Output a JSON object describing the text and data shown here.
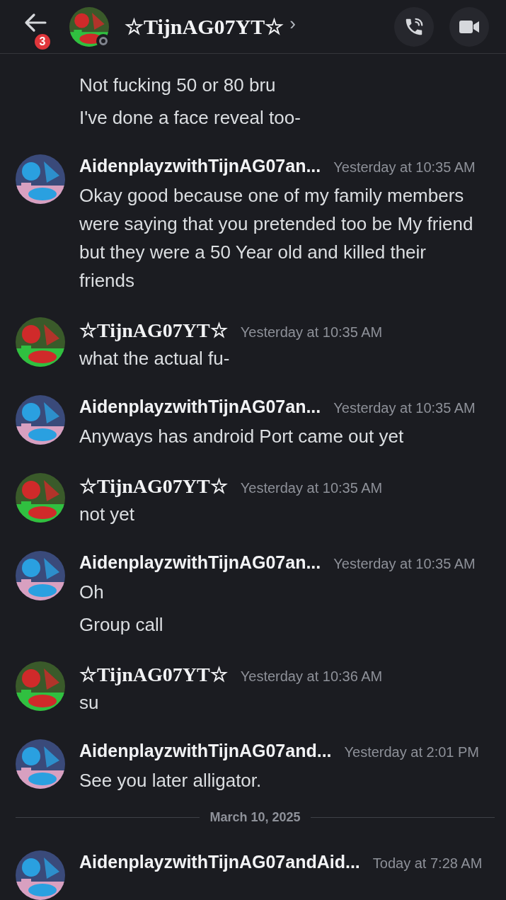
{
  "header": {
    "title": "☆TijnAG07YT☆",
    "chevron": "›",
    "badge": "3",
    "online": false
  },
  "feed": [
    {
      "kind": "continuation",
      "messages": [
        "Not fucking 50 or 80 bru",
        "I've done a face reveal too-"
      ]
    },
    {
      "kind": "group",
      "serif_name": false,
      "author": "AidenplayzwithTijnAG07an...",
      "time": "Yesterday at 10:35 AM",
      "messages": [
        "Okay good because one of my family members were saying that you pretended too be My friend but they were a 50 Year old and killed their friends"
      ]
    },
    {
      "kind": "group",
      "serif_name": true,
      "author": "☆TijnAG07YT☆",
      "time": "Yesterday at 10:35 AM",
      "messages": [
        "what the actual fu-"
      ]
    },
    {
      "kind": "group",
      "serif_name": false,
      "author": "AidenplayzwithTijnAG07an...",
      "time": "Yesterday at 10:35 AM",
      "messages": [
        "Anyways has android Port came out yet"
      ]
    },
    {
      "kind": "group",
      "serif_name": true,
      "author": "☆TijnAG07YT☆",
      "time": "Yesterday at 10:35 AM",
      "messages": [
        "not yet"
      ]
    },
    {
      "kind": "group",
      "serif_name": false,
      "author": "AidenplayzwithTijnAG07an...",
      "time": "Yesterday at 10:35 AM",
      "messages": [
        "Oh",
        "Group call"
      ]
    },
    {
      "kind": "group",
      "serif_name": true,
      "author": "☆TijnAG07YT☆",
      "time": "Yesterday at 10:36 AM",
      "messages": [
        "su"
      ]
    },
    {
      "kind": "group",
      "serif_name": false,
      "author": "AidenplayzwithTijnAG07and...",
      "time": "Yesterday at 2:01 PM",
      "messages": [
        "See you later alligator."
      ]
    },
    {
      "kind": "divider",
      "label": "March 10, 2025"
    },
    {
      "kind": "group",
      "serif_name": false,
      "author": "AidenplayzwithTijnAG07andAid...",
      "time": "Today at 7:28 AM"
    }
  ]
}
